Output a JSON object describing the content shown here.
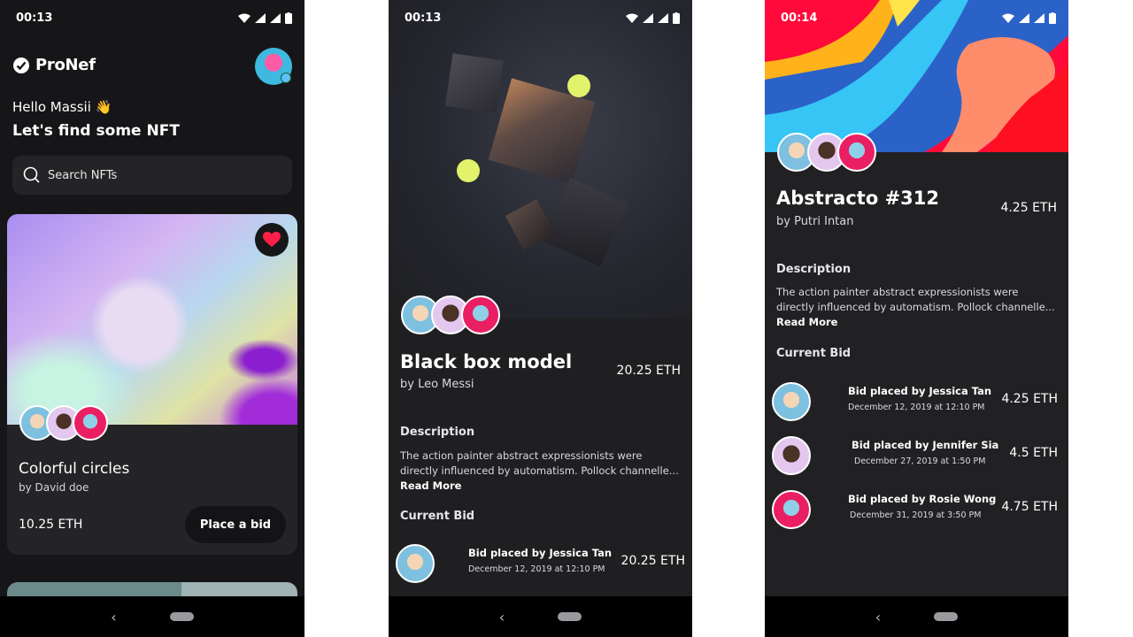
{
  "screen1": {
    "status": {
      "time": "00:13"
    },
    "brand": "ProNef",
    "greeting": "Hello Massii 👋",
    "headline": "Let's find some NFT",
    "search": {
      "placeholder": "Search NFTs"
    },
    "card": {
      "title": "Colorful circles",
      "author": "by David doe",
      "price": "10.25 ETH",
      "bid_button": "Place a bid"
    }
  },
  "screen2": {
    "status": {
      "time": "00:13"
    },
    "title": "Black box model",
    "author": "by Leo Messi",
    "price": "20.25 ETH",
    "description_heading": "Description",
    "description": "The action painter abstract expressionists were directly influenced by automatism. Pollock channelle...",
    "read_more": "Read More",
    "current_bid_heading": "Current Bid",
    "bids": [
      {
        "text": "Bid placed by Jessica Tan",
        "date": "December 12, 2019 at 12:10 PM",
        "amount": "20.25 ETH"
      }
    ]
  },
  "screen3": {
    "status": {
      "time": "00:14"
    },
    "title": "Abstracto #312",
    "author": "by Putri Intan",
    "price": "4.25 ETH",
    "description_heading": "Description",
    "description": "The action painter abstract expressionists were directly influenced by automatism. Pollock channelle...",
    "read_more": "Read More",
    "current_bid_heading": "Current Bid",
    "bids": [
      {
        "text": "Bid placed by Jessica Tan",
        "date": "December 12, 2019 at 12:10 PM",
        "amount": "4.25 ETH"
      },
      {
        "text": "Bid placed by Jennifer Sia",
        "date": "December 27, 2019 at 1:50 PM",
        "amount": "4.5 ETH"
      },
      {
        "text": "Bid placed by Rosie Wong",
        "date": "December 31, 2019 at 3:50 PM",
        "amount": "4.75 ETH"
      }
    ]
  },
  "colors": {
    "accent": "#e2f26a",
    "heart": "#ff1f46",
    "background": "#1f1f21"
  }
}
